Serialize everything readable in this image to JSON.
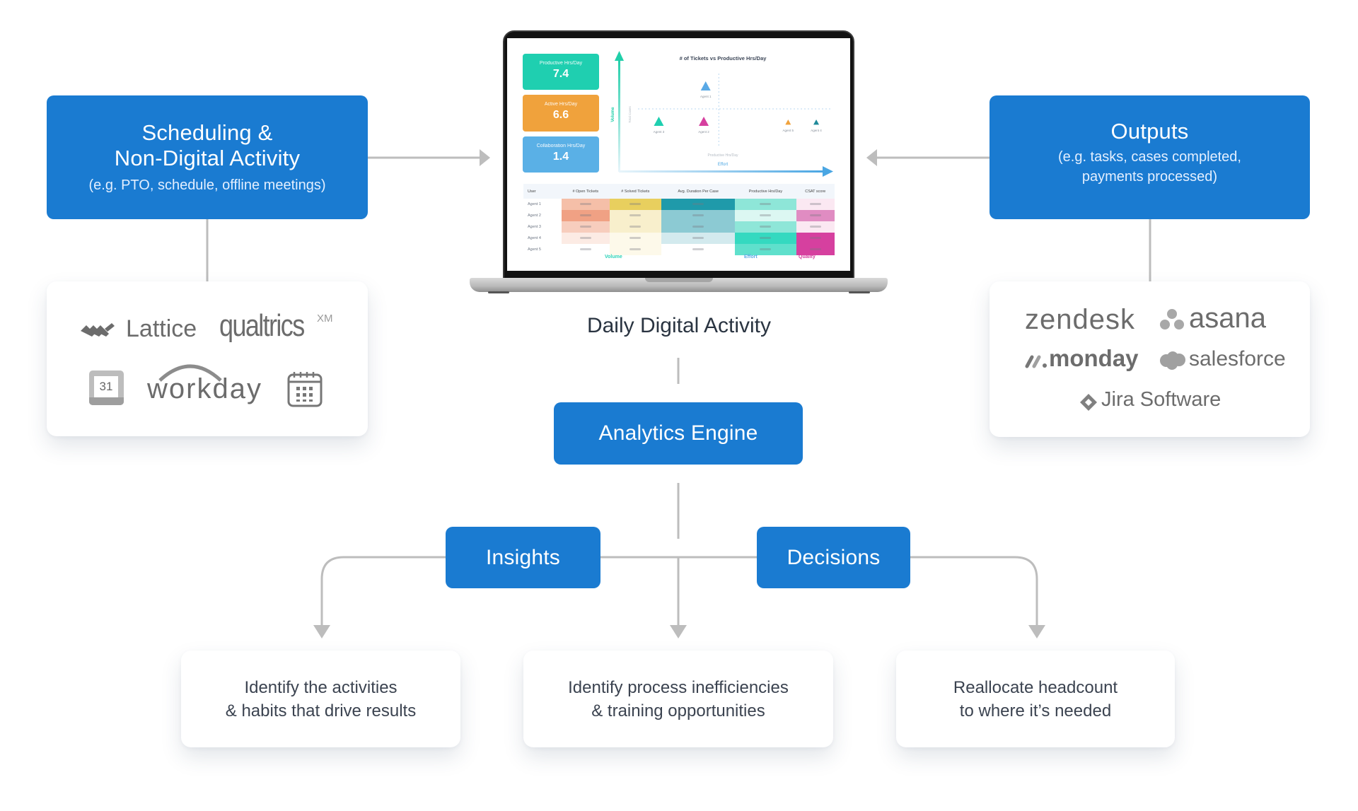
{
  "left_source": {
    "title_line1": "Scheduling &",
    "title_line2": "Non-Digital Activity",
    "subtitle": "(e.g. PTO, schedule, offline meetings)",
    "logos": [
      "Lattice",
      "qualtrics",
      "XM",
      "31",
      "workday",
      "calendar-icon"
    ]
  },
  "right_source": {
    "title": "Outputs",
    "subtitle_line1": "(e.g. tasks, cases completed,",
    "subtitle_line2": "payments processed)",
    "logos": [
      "zendesk",
      "asana",
      "monday",
      "salesforce",
      "Jira Software"
    ]
  },
  "center": {
    "caption": "Daily Digital Activity",
    "engine": "Analytics Engine",
    "insights": "Insights",
    "decisions": "Decisions"
  },
  "outcomes": [
    {
      "line1": "Identify the activities",
      "line2": "& habits that drive results"
    },
    {
      "line1": "Identify process inefficiencies",
      "line2": "& training opportunities"
    },
    {
      "line1": "Reallocate headcount",
      "line2": "to where it’s needed"
    }
  ],
  "dashboard": {
    "kpis": [
      {
        "label": "Productive Hrs/Day",
        "value": "7.4",
        "color": "#1fcfb0"
      },
      {
        "label": "Active Hrs/Day",
        "value": "6.6",
        "color": "#f0a23c"
      },
      {
        "label": "Collaboration Hrs/Day",
        "value": "1.4",
        "color": "#5ab0e6"
      }
    ],
    "chart_data": {
      "type": "scatter",
      "title": "# of Tickets vs Productive Hrs/Day",
      "xlabel": "Productive Hrs/Day",
      "xaxis_group": "Effort",
      "ylabel": "Total Cases",
      "yaxis_group": "Volume",
      "points": [
        {
          "name": "Agent 1",
          "x": 0.38,
          "y": 0.82,
          "size": "large",
          "color": "#5aa9e6"
        },
        {
          "name": "Agent 2",
          "x": 0.37,
          "y": 0.32,
          "size": "large",
          "color": "#d6409f"
        },
        {
          "name": "Agent 3",
          "x": 0.13,
          "y": 0.32,
          "size": "large",
          "color": "#1fcfb0"
        },
        {
          "name": "Agent 4",
          "x": 0.97,
          "y": 0.31,
          "size": "small",
          "color": "#1f8a9a"
        },
        {
          "name": "Agent 5",
          "x": 0.82,
          "y": 0.31,
          "size": "small",
          "color": "#f0a23c"
        }
      ],
      "quadrant_lines": {
        "x": 0.45,
        "y": 0.5
      }
    },
    "table": {
      "headers": [
        "User",
        "# Open Tickets",
        "# Solved Tickets",
        "Avg. Duration Per Case",
        "Productive Hrs/Day",
        "CSAT score"
      ],
      "rows": [
        "Agent 1",
        "Agent 2",
        "Agent 3",
        "Agent 4",
        "Agent 5"
      ],
      "heat": [
        [
          "#f5bfa8",
          "#e8cf5e",
          "#1f9aaa",
          "#8ee6d8",
          "#fbe8f2"
        ],
        [
          "#f0a184",
          "#f8efcc",
          "#8ccad3",
          "#dcf7f2",
          "#e08cc2"
        ],
        [
          "#f7cdbd",
          "#f8efcc",
          "#8ccad3",
          "#8ee6d8",
          "#fbe8f2"
        ],
        [
          "#fcebe4",
          "#fdf9ea",
          "#d3eaee",
          "#34d9c0",
          "#d6409f"
        ],
        [
          "#ffffff",
          "#fdf9ea",
          "#ffffff",
          "#5fe0cc",
          "#d6409f"
        ]
      ],
      "groups": [
        {
          "label": "Volume",
          "color": "#2fd3b9"
        },
        {
          "label": "Effort",
          "color": "#5aa9e6"
        },
        {
          "label": "Quality",
          "color": "#d6409f"
        }
      ]
    }
  }
}
